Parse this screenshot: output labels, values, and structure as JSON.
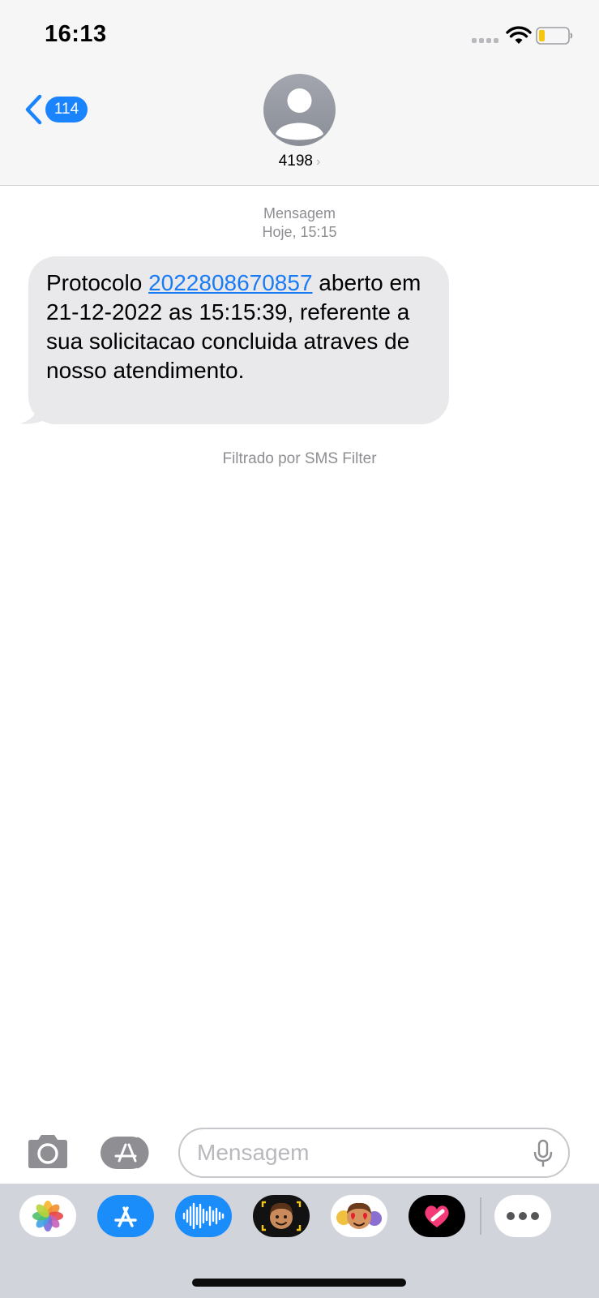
{
  "status_bar": {
    "time": "16:13"
  },
  "header": {
    "back_badge": "114",
    "contact_name": "4198",
    "contact_chevron": "›"
  },
  "conversation": {
    "message_type": "Mensagem",
    "date_label": "Hoje, 15:15",
    "message": {
      "text_before": "Protocolo ",
      "link": "2022808670857",
      "text_after": " aberto em 21-12-2022 as 15:15:39, referente a sua solicitacao concluida atraves de nosso atendimento."
    },
    "filter_note": "Filtrado por SMS Filter"
  },
  "input_bar": {
    "placeholder": "Mensagem",
    "value": ""
  },
  "drawer_apps": [
    {
      "name": "photos-app-icon"
    },
    {
      "name": "app-store-icon"
    },
    {
      "name": "audio-message-icon"
    },
    {
      "name": "memoji-camera-icon"
    },
    {
      "name": "memoji-stickers-icon"
    },
    {
      "name": "digital-touch-icon"
    },
    {
      "name": "more-apps-icon"
    }
  ],
  "colors": {
    "accent": "#1a84ff",
    "link": "#1a7cf5",
    "bubble_incoming": "#e9e9eb",
    "header_bg": "#f6f6f6",
    "drawer_bg": "#d1d4db",
    "meta_text": "#8e8e93"
  }
}
